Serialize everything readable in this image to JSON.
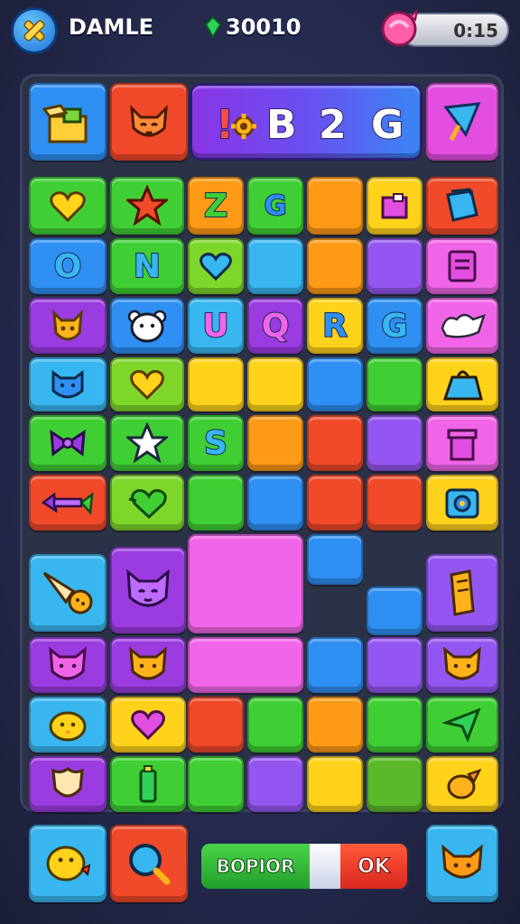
{
  "header": {
    "player_name": "DAMLE",
    "score": "30010",
    "timer": "0:15"
  },
  "banner": {
    "symbol": "!",
    "letters": [
      "B",
      "2",
      "G"
    ]
  },
  "grid_letters": {
    "r1c3": "Z",
    "r1c4": "G",
    "r2c1": "O",
    "r2c2": "N",
    "r3c3": "U",
    "r3c4": "Q",
    "r3c5": "R",
    "r3c6": "G",
    "r5c3": "S"
  },
  "controls": {
    "left_label": "BOPIOR",
    "right_label": "OK"
  },
  "colors": {
    "blue": "#2f8ff2",
    "red": "#f04a2a",
    "purple": "#9a3ce0",
    "magenta": "#e24fe0",
    "green": "#3fcf34",
    "lime": "#7ed62a",
    "orange": "#ff9a16",
    "yellow": "#ffd21c",
    "sky": "#38b6f0",
    "violet": "#9456f0",
    "pink": "#f065e8"
  }
}
